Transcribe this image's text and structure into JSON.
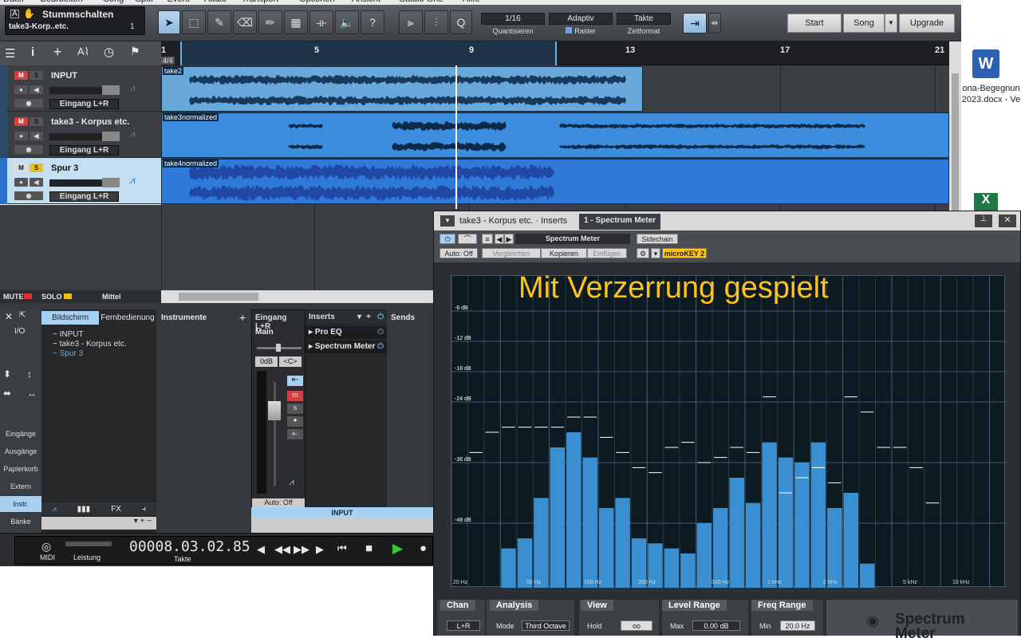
{
  "menu": [
    "Datei",
    "Bearbeiten",
    "Song",
    "Spur",
    "Event",
    "Audio",
    "Transport",
    "Optionen",
    "Ansicht",
    "Studio One",
    "Hilfe"
  ],
  "song": {
    "title": "Stummschalten",
    "subtitle": "take3-Korp..etc.",
    "count": "1"
  },
  "tools": {
    "quantize": "1/16",
    "quantize_cap": "Quantisieren",
    "grid": "Adaptiv",
    "grid_cap": "Raster",
    "timeformat": "Takte",
    "timeformat_cap": "Zeitformat",
    "help": "?",
    "zoom": "Q"
  },
  "header_buttons": {
    "start": "Start",
    "song": "Song",
    "upgrade": "Upgrade"
  },
  "ruler": {
    "signature": "4/4",
    "bars": [
      "1",
      "5",
      "9",
      "13",
      "17",
      "21"
    ]
  },
  "tracks": [
    {
      "name": "INPUT",
      "input": "Eingang L+R",
      "m": "M",
      "s": "S"
    },
    {
      "name": "take3 - Korpus etc.",
      "input": "Eingang L+R",
      "m": "M",
      "s": "S"
    },
    {
      "name": "Spur 3",
      "input": "Eingang L+R",
      "m": "M",
      "s": "S"
    }
  ],
  "clips": [
    "take2",
    "take3normalized",
    "take4normalized"
  ],
  "mutebar": {
    "mute": "MUTE",
    "solo": "SOLO",
    "mode": "Mittel"
  },
  "browser": {
    "tab1": "Bildschirm",
    "tab2": "Fernbedienung",
    "io": "I/O",
    "items": [
      "INPUT",
      "take3 - Korpus etc.",
      "Spur 3"
    ],
    "nav": [
      "Eingänge",
      "Ausgänge",
      "Papierkorb",
      "Extern",
      "Instr.",
      "Bänke"
    ]
  },
  "instruments": {
    "title": "Instrumente"
  },
  "channel": {
    "input": "Eingang L+R",
    "main": "Main",
    "db": "0dB",
    "pan": "<C>",
    "auto": "Auto: Off",
    "name": "INPUT"
  },
  "inserts": {
    "title": "Inserts",
    "items": [
      "Pro EQ",
      "Spectrum Meter"
    ]
  },
  "sends": {
    "title": "Sends"
  },
  "transport": {
    "midi": "MIDI",
    "perf": "Leistung",
    "time": "00008.03.02.85",
    "unit": "Takte"
  },
  "desktop": {
    "word_file": "ona-Begegnun 2023.docx - Ve"
  },
  "plugin": {
    "tab1": "take3 - Korpus etc. · Inserts",
    "tab2": "1 - Spectrum Meter",
    "preset": "Spectrum Meter",
    "sidechain": "Sidechain",
    "auto": "Auto: Off",
    "compare": "Vergleichen",
    "copy": "Kopieren",
    "paste": "Einfügen",
    "key": "microKEY 2",
    "overlay": "Mit Verzerrung gespielt",
    "db_labels": [
      "-6 dB",
      "-12 dB",
      "-18 dB",
      "-24 dB",
      "-36 dB",
      "-48 dB"
    ],
    "freq_labels": [
      "20 Hz",
      "50 Hz",
      "100 Hz",
      "200 Hz",
      "500 Hz",
      "1 kHz",
      "2 kHz",
      "5 kHz",
      "10 kHz"
    ],
    "sections": {
      "chan": "Chan",
      "chan_val": "L+R",
      "analysis": "Analysis",
      "mode": "Mode",
      "mode_val": "Third Octave",
      "view": "View",
      "hold": "Hold",
      "hold_val": "oo",
      "level": "Level Range",
      "max": "Max",
      "max_val": "0.00 dB",
      "freq": "Freq Range",
      "min": "Min",
      "min_val": "20.0 Hz"
    },
    "brand": "Spectrum Meter"
  },
  "spectrum": {
    "unit": "dB",
    "bands": 34,
    "bar_db": [
      -61,
      -53,
      -51,
      -43,
      -33,
      -30,
      -35,
      -45,
      -43,
      -51,
      -52,
      -53,
      -54,
      -48,
      -45,
      -39,
      -44,
      -32,
      -35,
      -36,
      -32,
      -45,
      -42,
      -56
    ],
    "bar_start_band": 2,
    "peak_db": [
      -34,
      -30,
      -29,
      -29,
      -29,
      -29,
      -27,
      -27,
      -31,
      -34,
      -37,
      -38,
      -33,
      -32,
      -36,
      -35,
      -33,
      -34,
      -23,
      -42,
      -39,
      -37,
      -40,
      -23,
      -26,
      -33,
      -33,
      -37,
      -44
    ]
  },
  "colors": {
    "bar": "#3a8fd0",
    "clip": "#3d8ddf",
    "accent": "#ffc21a"
  }
}
